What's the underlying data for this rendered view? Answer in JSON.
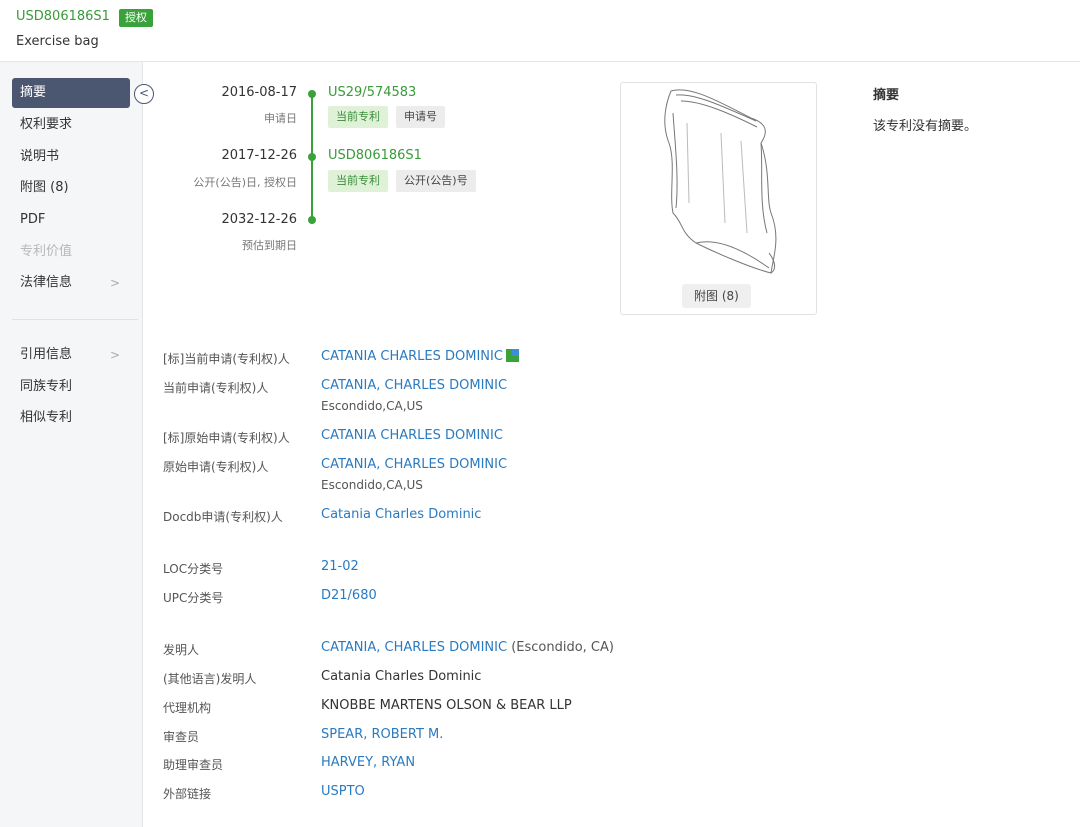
{
  "header": {
    "patent_number": "USD806186S1",
    "status_badge": "授权",
    "title": "Exercise bag"
  },
  "sidebar": {
    "items": [
      {
        "label": "摘要",
        "active": true
      },
      {
        "label": "权利要求"
      },
      {
        "label": "说明书"
      },
      {
        "label": "附图 (8)"
      },
      {
        "label": "PDF"
      },
      {
        "label": "专利价值",
        "disabled": true
      },
      {
        "label": "法律信息",
        "has_chevron": true
      }
    ],
    "items2": [
      {
        "label": "引用信息",
        "has_chevron": true
      },
      {
        "label": "同族专利"
      },
      {
        "label": "相似专利"
      }
    ],
    "chevron": ">",
    "collapse_icon": "<"
  },
  "timeline": [
    {
      "date": "2016-08-17",
      "label": "申请日",
      "number": "US29/574583",
      "tags": [
        "当前专利",
        "申请号"
      ]
    },
    {
      "date": "2017-12-26",
      "label": "公开(公告)日, 授权日",
      "number": "USD806186S1",
      "tags": [
        "当前专利",
        "公开(公告)号"
      ]
    },
    {
      "date": "2032-12-26",
      "label": "预估到期日"
    }
  ],
  "drawing": {
    "button": "附图 (8)"
  },
  "abstract": {
    "heading": "摘要",
    "text": "该专利没有摘要。"
  },
  "fields": {
    "std_current_assignee": {
      "label": "[标]当前申请(专利权)人",
      "value": "CATANIA CHARLES DOMINIC"
    },
    "current_assignee": {
      "label": "当前申请(专利权)人",
      "value": "CATANIA, CHARLES DOMINIC",
      "address": "Escondido,CA,US"
    },
    "std_original_assignee": {
      "label": "[标]原始申请(专利权)人",
      "value": "CATANIA CHARLES DOMINIC"
    },
    "original_assignee": {
      "label": "原始申请(专利权)人",
      "value": "CATANIA, CHARLES DOMINIC",
      "address": "Escondido,CA,US"
    },
    "docdb_assignee": {
      "label": "Docdb申请(专利权)人",
      "value": "Catania Charles Dominic"
    },
    "loc": {
      "label": "LOC分类号",
      "value": "21-02"
    },
    "upc": {
      "label": "UPC分类号",
      "value": "D21/680"
    },
    "inventor": {
      "label": "发明人",
      "value": "CATANIA, CHARLES DOMINIC",
      "suffix": "(Escondido, CA)"
    },
    "inventor_other": {
      "label": "(其他语言)发明人",
      "value": "Catania Charles Dominic"
    },
    "agency": {
      "label": "代理机构",
      "value": "KNOBBE MARTENS OLSON & BEAR LLP"
    },
    "examiner": {
      "label": "审查员",
      "value": "SPEAR, ROBERT M."
    },
    "assistant_examiner": {
      "label": "助理审查员",
      "value": "HARVEY, RYAN"
    },
    "external_link": {
      "label": "外部链接",
      "value": "USPTO"
    }
  }
}
